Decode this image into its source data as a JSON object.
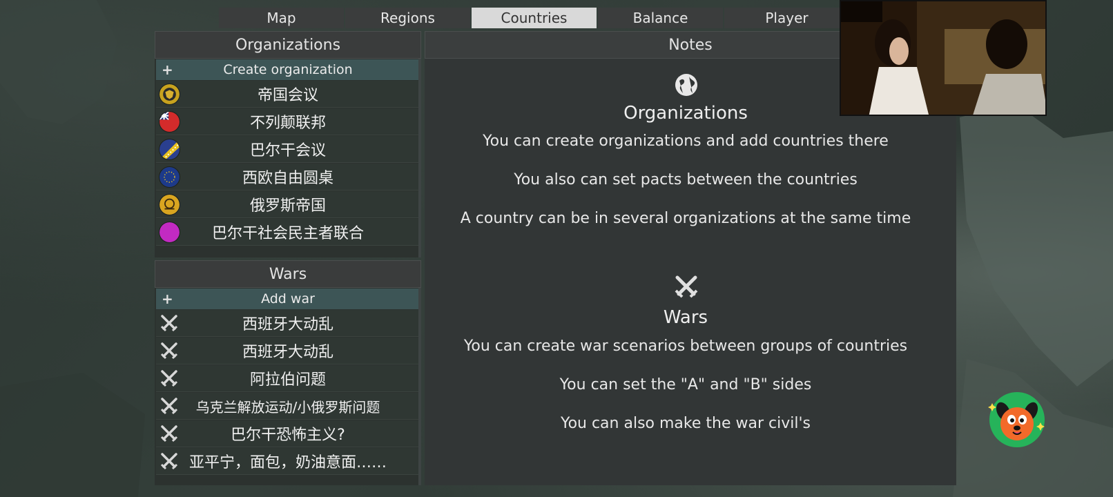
{
  "tabs": [
    {
      "label": "Map",
      "active": false
    },
    {
      "label": "Regions",
      "active": false
    },
    {
      "label": "Countries",
      "active": true
    },
    {
      "label": "Balance",
      "active": false
    },
    {
      "label": "Player",
      "active": false
    }
  ],
  "organizations": {
    "title": "Organizations",
    "add_label": "Create organization",
    "items": [
      {
        "name": "帝国会议",
        "flag_color": "#c8a21e"
      },
      {
        "name": "不列颠联邦",
        "flag_color": "#d42b2b"
      },
      {
        "name": "巴尔干会议",
        "flag_color": "#2a3f8f"
      },
      {
        "name": "西欧自由圆桌",
        "flag_color": "#1d3a8a"
      },
      {
        "name": "俄罗斯帝国",
        "flag_color": "#d9a520"
      },
      {
        "name": "巴尔干社会民主者联合",
        "flag_color": "#c22ac2"
      }
    ]
  },
  "wars": {
    "title": "Wars",
    "add_label": "Add war",
    "items": [
      {
        "name": "西班牙大动乱"
      },
      {
        "name": "西班牙大动乱"
      },
      {
        "name": "阿拉伯问题"
      },
      {
        "name": "乌克兰解放运动/小俄罗斯问题"
      },
      {
        "name": "巴尔干恐怖主义?"
      },
      {
        "name": "亚平宁，面包，奶油意面……"
      }
    ]
  },
  "notes": {
    "title": "Notes",
    "organizations_heading": "Organizations",
    "organizations_lines": [
      "You can create organizations and add countries there",
      "You also can set pacts between the countries",
      "A country can be in several organizations at the same time"
    ],
    "wars_heading": "Wars",
    "wars_lines": [
      "You can create war scenarios between groups of countries",
      "You can set the \"A\" and \"B\" sides",
      "You can also make the war civil's"
    ]
  }
}
